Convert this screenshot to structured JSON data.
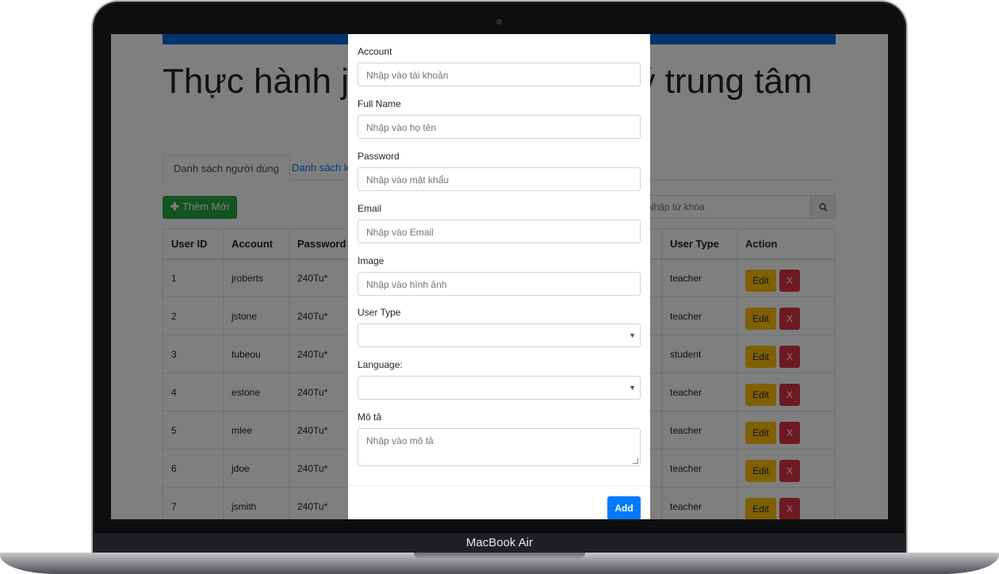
{
  "device": {
    "label": "MacBook Air"
  },
  "page": {
    "title": "Thực hành java - Dự án quản lý trung tâm",
    "tabs": [
      {
        "label": "Danh sách người dùng",
        "active": true
      },
      {
        "label": "Danh sách khóa học",
        "active": false
      }
    ],
    "add_button": "Thêm Mới",
    "search_placeholder": "Nhập từ khóa",
    "table": {
      "headers": [
        "User ID",
        "Account",
        "Password",
        "User Type",
        "Action"
      ],
      "rows": [
        {
          "id": "1",
          "account": "jroberts",
          "password": "240Tu*",
          "type": "teacher"
        },
        {
          "id": "2",
          "account": "jstone",
          "password": "240Tu*",
          "type": "teacher"
        },
        {
          "id": "3",
          "account": "tubeou",
          "password": "240Tu*",
          "type": "student"
        },
        {
          "id": "4",
          "account": "estone",
          "password": "240Tu*",
          "type": "teacher"
        },
        {
          "id": "5",
          "account": "mlee",
          "password": "240Tu*",
          "type": "teacher"
        },
        {
          "id": "6",
          "account": "jdoe",
          "password": "240Tu*",
          "type": "teacher"
        },
        {
          "id": "7",
          "account": "jsmith",
          "password": "240Tu*",
          "type": "teacher"
        }
      ],
      "edit_label": "Edit",
      "delete_label": "X"
    }
  },
  "modal": {
    "account": {
      "label": "Account",
      "placeholder": "Nhập vào tài khoản"
    },
    "fullname": {
      "label": "Full Name",
      "placeholder": "Nhập vào họ tên"
    },
    "password": {
      "label": "Password",
      "placeholder": "Nhập vào mật khẩu"
    },
    "email": {
      "label": "Email",
      "placeholder": "Nhập vào Email"
    },
    "image": {
      "label": "Image",
      "placeholder": "Nhập vào hình ảnh"
    },
    "usertype": {
      "label": "User Type",
      "value": ""
    },
    "language": {
      "label": "Language:",
      "value": ""
    },
    "description": {
      "label": "Mô tả",
      "placeholder": "Nhập vào mô tả"
    },
    "submit": "Add"
  },
  "colors": {
    "primary": "#007bff",
    "success": "#28a745",
    "warning": "#ffc107",
    "danger": "#dc3545"
  }
}
